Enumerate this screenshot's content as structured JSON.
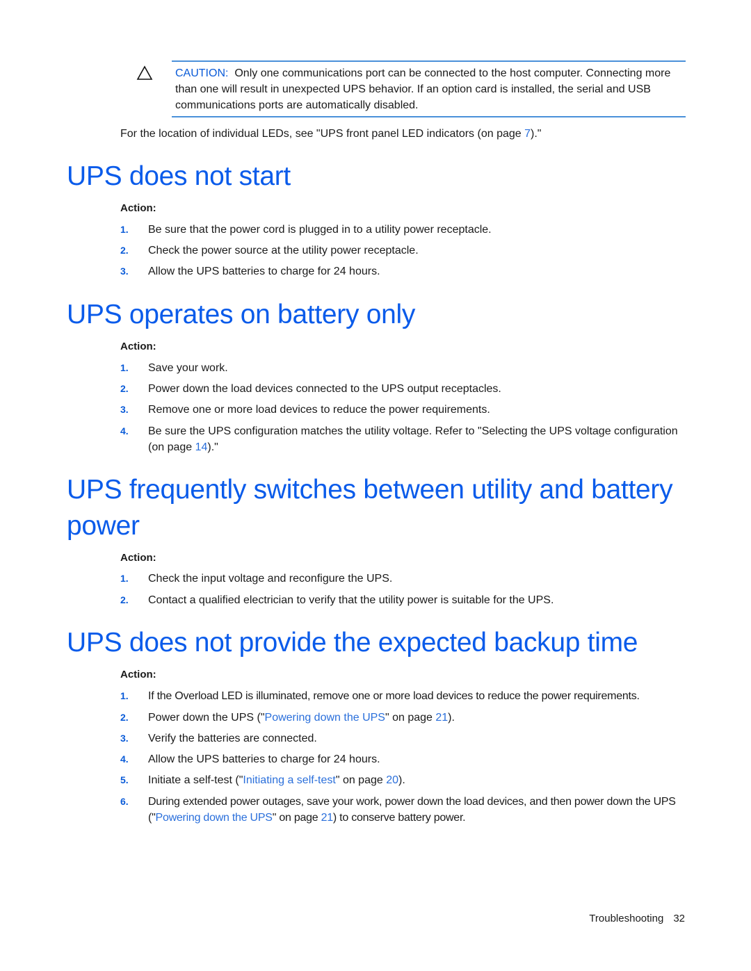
{
  "caution": {
    "icon": "warning-triangle-icon",
    "label": "CAUTION:",
    "text": "Only one communications port can be connected to the host computer. Connecting more than one will result in unexpected UPS behavior. If an option card is installed, the serial and USB communications ports are automatically disabled."
  },
  "intro": {
    "before": "For the location of individual LEDs, see \"UPS front panel LED indicators (on page ",
    "page_link": "7",
    "after": ").\""
  },
  "sections": [
    {
      "title": "UPS does not start",
      "action_label": "Action:",
      "items": [
        {
          "num": "1.",
          "text": "Be sure that the power cord is plugged in to a utility power receptacle."
        },
        {
          "num": "2.",
          "text": "Check the power source at the utility power receptacle."
        },
        {
          "num": "3.",
          "text": "Allow the UPS batteries to charge for 24 hours."
        }
      ]
    },
    {
      "title": "UPS operates on battery only",
      "action_label": "Action:",
      "items": [
        {
          "num": "1.",
          "text": "Save your work."
        },
        {
          "num": "2.",
          "text": "Power down the load devices connected to the UPS output receptacles."
        },
        {
          "num": "3.",
          "text": "Remove one or more load devices to reduce the power requirements."
        },
        {
          "num": "4.",
          "text_before": "Be sure the UPS configuration matches the utility voltage. Refer to \"Selecting the UPS voltage configuration (on page ",
          "link": "14",
          "text_after": ").\""
        }
      ]
    },
    {
      "title_line1": "UPS frequently switches between utility and battery",
      "title_line2": "power",
      "action_label": "Action:",
      "items": [
        {
          "num": "1.",
          "text": "Check the input voltage and reconfigure the UPS."
        },
        {
          "num": "2.",
          "text": "Contact a qualified electrician to verify that the utility power is suitable for the UPS."
        }
      ]
    },
    {
      "title": "UPS does not provide the expected backup time",
      "action_label": "Action:",
      "items": [
        {
          "num": "1.",
          "text": "If the Overload LED is illuminated, remove one or more load devices to reduce the power requirements."
        },
        {
          "num": "2.",
          "text_before": "Power down the UPS (\"",
          "link": "Powering down the UPS",
          "text_mid": "\" on page ",
          "page": "21",
          "text_after": ")."
        },
        {
          "num": "3.",
          "text": "Verify the batteries are connected."
        },
        {
          "num": "4.",
          "text": "Allow the UPS batteries to charge for 24 hours."
        },
        {
          "num": "5.",
          "text_before": "Initiate a self-test (\"",
          "link": "Initiating a self-test",
          "text_mid": "\" on page ",
          "page": "20",
          "text_after": ")."
        },
        {
          "num": "6.",
          "text_before": "During extended power outages, save your work, power down the load devices, and then power down the UPS (\"",
          "link": "Powering down the UPS",
          "text_mid": "\" on page ",
          "page": "21",
          "text_after": ") to conserve battery power."
        }
      ]
    }
  ],
  "footer": {
    "section": "Troubleshooting",
    "page_number": "32"
  },
  "colors": {
    "heading": "#0a5bea",
    "link": "#2a6fdb",
    "rule": "#4a90d9"
  }
}
